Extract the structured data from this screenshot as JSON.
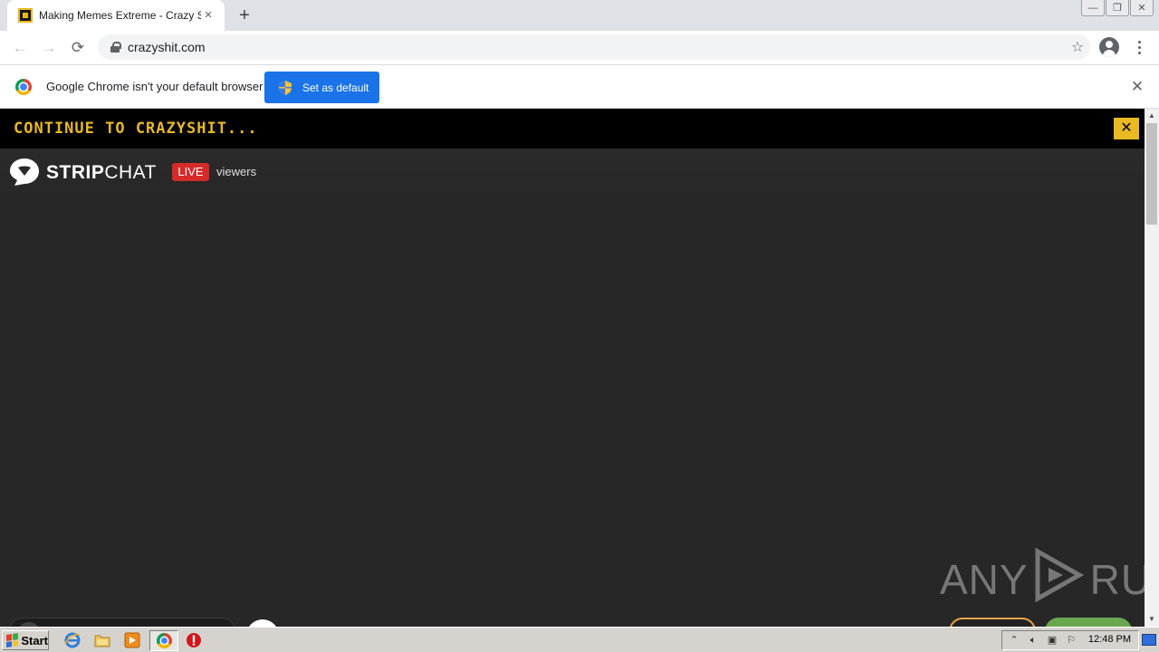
{
  "browser": {
    "tab": {
      "title": "Making Memes Extreme - Crazy Shit",
      "close": "×"
    },
    "new_tab": "+",
    "window_controls": {
      "minimize": "—",
      "restore": "❐",
      "close": "✕"
    },
    "toolbar": {
      "back": "←",
      "forward": "→",
      "reload": "⟳",
      "url": "crazyshit.com",
      "bookmark": "☆"
    },
    "infobar": {
      "message": "Google Chrome isn't your default browser",
      "button_label": "Set as default",
      "close": "✕"
    }
  },
  "page": {
    "promo": {
      "text": "CONTINUE TO CRAZYSHIT...",
      "close": "✕"
    },
    "player": {
      "brand_bold": "STRIP",
      "brand_regular": "CHAT",
      "live_label": "LIVE",
      "viewers_label": "viewers"
    },
    "watermark": {
      "left": "ANY",
      "right": "RUN"
    }
  },
  "taskbar": {
    "start_label": "Start",
    "clock": "12:48 PM"
  },
  "colors": {
    "accent_yellow": "#e8b923",
    "chrome_blue": "#1a73e8",
    "live_red": "#d52b2b",
    "page_bg": "#272727"
  },
  "icons": [
    "back-arrow-icon",
    "forward-arrow-icon",
    "reload-icon",
    "lock-icon",
    "star-icon",
    "profile-icon",
    "menu-dots-icon",
    "chrome-logo-icon",
    "shield-icon",
    "stripchat-logo-icon",
    "play-icon"
  ]
}
